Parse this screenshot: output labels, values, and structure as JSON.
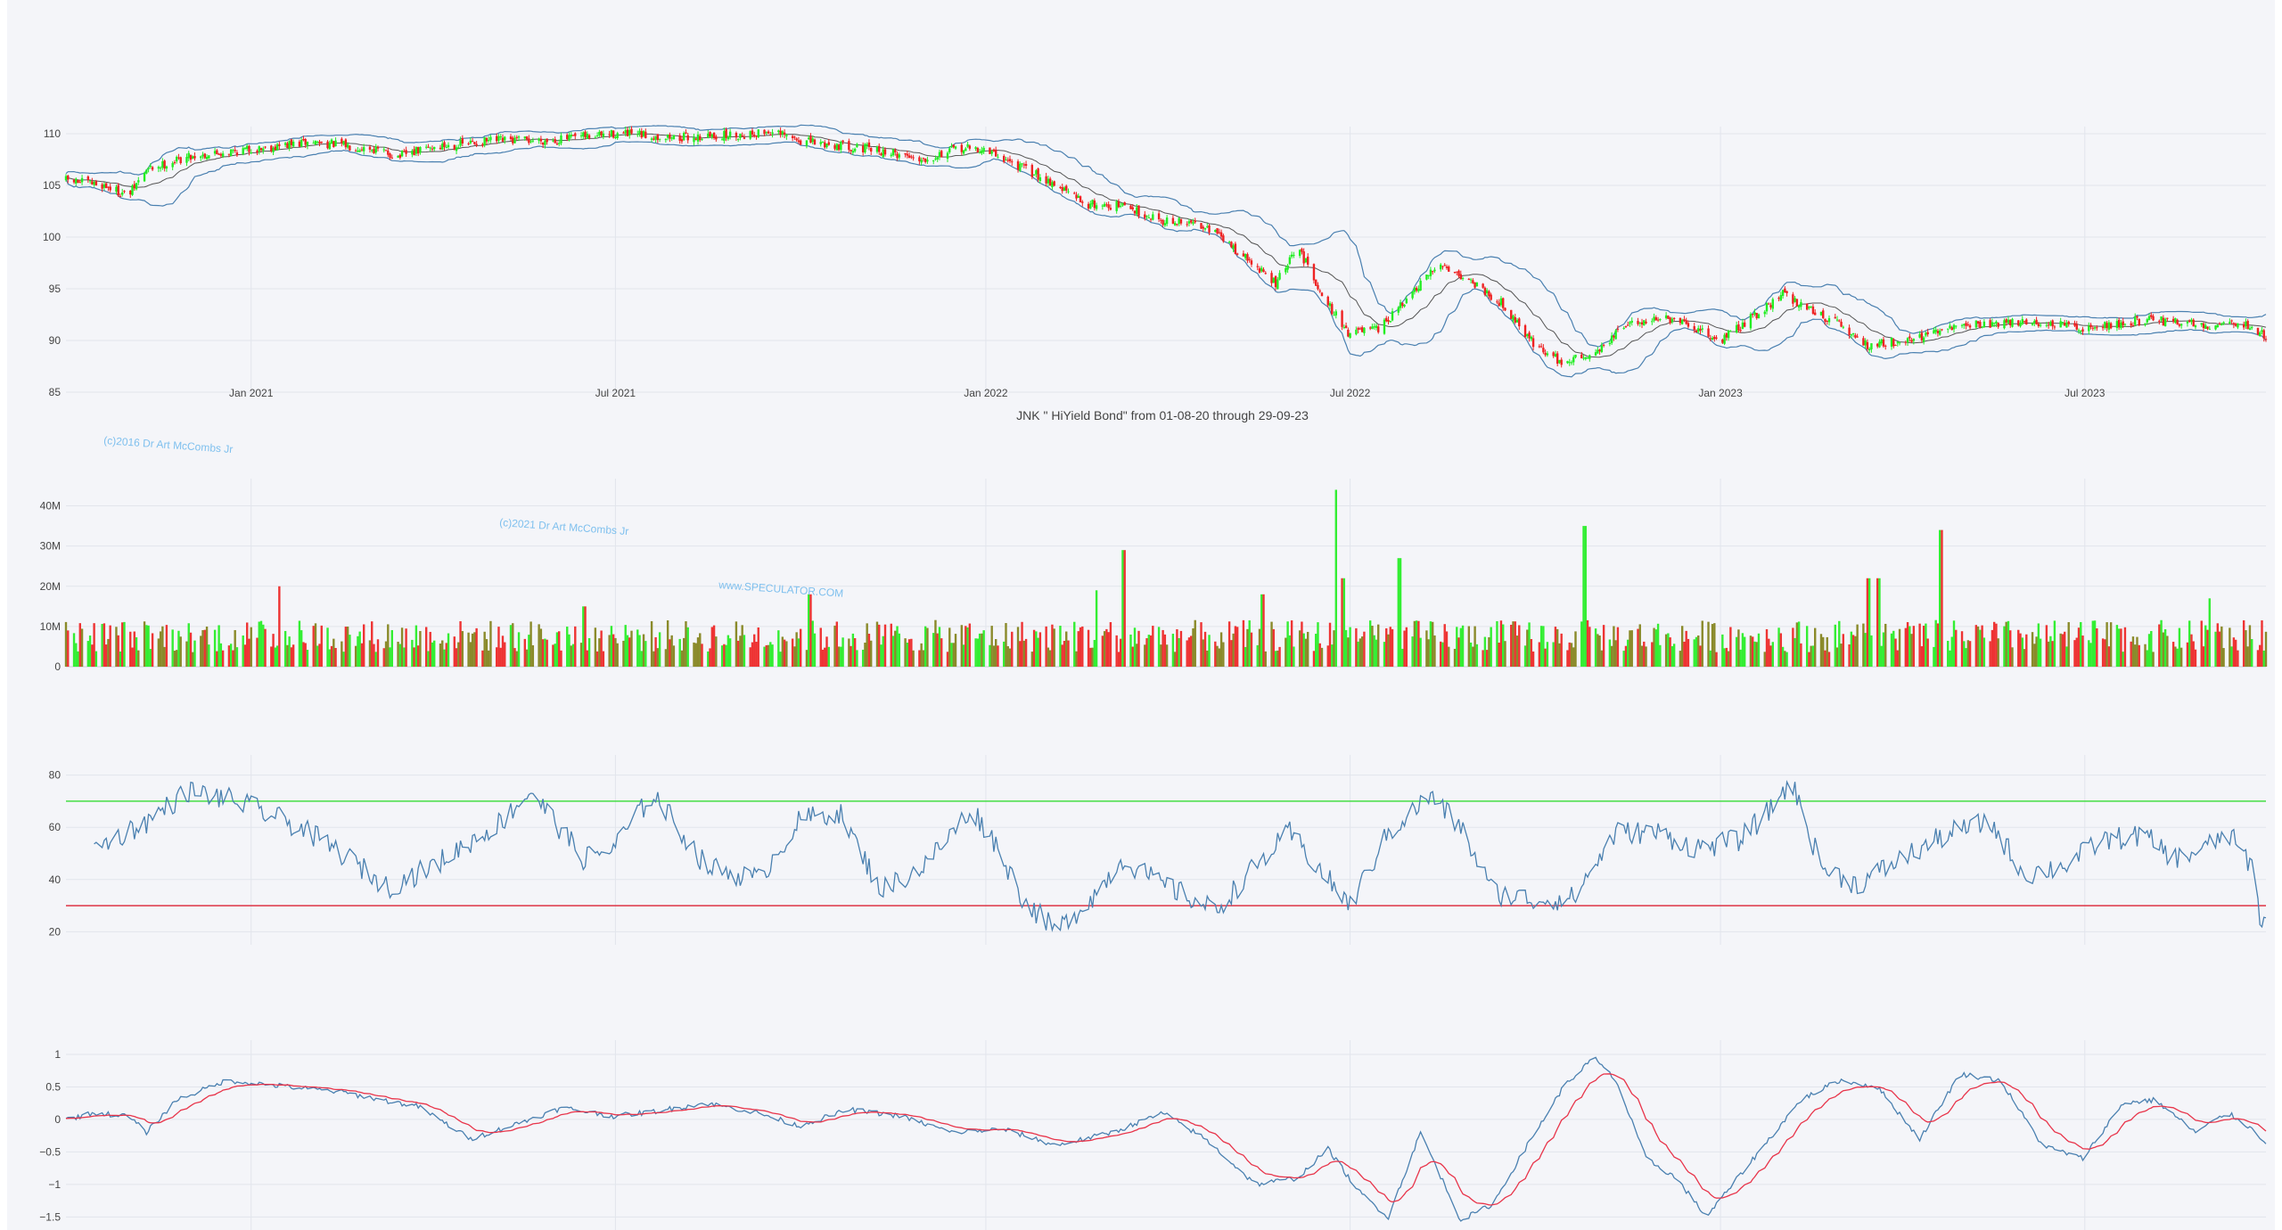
{
  "colors": {
    "background": "#f4f5f9",
    "grid": "#e2e5ec",
    "axis_text": "#444444",
    "up": "#22ee22",
    "down": "#ee2222",
    "band": "#4a80b0",
    "signal": "#e8344a",
    "overbought": "#44dd44",
    "oversold": "#dd3344",
    "watermark": "#7fc0ee"
  },
  "chart_data": [
    {
      "type": "candlestick",
      "title": "JNK \" HiYield Bond\" from 01-08-20 through 29-09-23",
      "x_ticks": [
        "Jan 2021",
        "Jul 2021",
        "Jan 2022",
        "Jul 2022",
        "Jan 2023",
        "Jul 2023"
      ],
      "x_range": [
        "2020-10-01",
        "2023-09-29"
      ],
      "y_ticks": [
        "85",
        "90",
        "95",
        "100",
        "105",
        "110"
      ],
      "ylim": [
        85,
        110
      ],
      "close_keypoints": [
        [
          "2020-10-01",
          105.5
        ],
        [
          "2020-10-20",
          105.0
        ],
        [
          "2020-11-01",
          104.0
        ],
        [
          "2020-11-10",
          106.5
        ],
        [
          "2020-12-01",
          107.8
        ],
        [
          "2021-01-01",
          108.5
        ],
        [
          "2021-02-01",
          109.2
        ],
        [
          "2021-03-01",
          108.6
        ],
        [
          "2021-03-15",
          107.8
        ],
        [
          "2021-04-01",
          108.7
        ],
        [
          "2021-05-01",
          109.3
        ],
        [
          "2021-06-01",
          109.4
        ],
        [
          "2021-07-01",
          110.0
        ],
        [
          "2021-08-01",
          109.6
        ],
        [
          "2021-09-01",
          109.9
        ],
        [
          "2021-09-15",
          110.2
        ],
        [
          "2021-10-01",
          109.3
        ],
        [
          "2021-11-01",
          108.6
        ],
        [
          "2021-12-01",
          107.6
        ],
        [
          "2021-12-20",
          108.6
        ],
        [
          "2022-01-01",
          108.4
        ],
        [
          "2022-02-01",
          105.5
        ],
        [
          "2022-02-20",
          103.2
        ],
        [
          "2022-03-10",
          103.0
        ],
        [
          "2022-04-01",
          101.5
        ],
        [
          "2022-04-20",
          101.2
        ],
        [
          "2022-05-10",
          98.0
        ],
        [
          "2022-05-25",
          95.5
        ],
        [
          "2022-06-05",
          99.0
        ],
        [
          "2022-06-20",
          93.5
        ],
        [
          "2022-06-30",
          90.8
        ],
        [
          "2022-07-15",
          91.0
        ],
        [
          "2022-08-01",
          94.5
        ],
        [
          "2022-08-15",
          97.5
        ],
        [
          "2022-09-01",
          95.5
        ],
        [
          "2022-09-15",
          93.5
        ],
        [
          "2022-10-01",
          89.5
        ],
        [
          "2022-10-15",
          87.8
        ],
        [
          "2022-11-01",
          89.0
        ],
        [
          "2022-11-15",
          91.5
        ],
        [
          "2022-12-01",
          92.2
        ],
        [
          "2022-12-15",
          91.5
        ],
        [
          "2023-01-01",
          90.0
        ],
        [
          "2023-01-15",
          92.0
        ],
        [
          "2023-02-01",
          94.5
        ],
        [
          "2023-02-15",
          93.0
        ],
        [
          "2023-03-01",
          91.5
        ],
        [
          "2023-03-15",
          89.5
        ],
        [
          "2023-04-01",
          90.0
        ],
        [
          "2023-04-15",
          90.5
        ],
        [
          "2023-05-01",
          91.5
        ],
        [
          "2023-06-01",
          91.8
        ],
        [
          "2023-07-01",
          91.2
        ],
        [
          "2023-08-01",
          92.0
        ],
        [
          "2023-09-01",
          91.5
        ],
        [
          "2023-09-15",
          91.8
        ],
        [
          "2023-09-29",
          90.5
        ]
      ],
      "bollinger": true
    },
    {
      "type": "bar",
      "name": "volume",
      "x_range": [
        "2020-10-01",
        "2023-09-29"
      ],
      "y_ticks": [
        "0",
        "10M",
        "20M",
        "30M",
        "40M"
      ],
      "ylim": [
        0,
        45000000
      ],
      "typical_volume": 8000000,
      "spikes": [
        [
          "2021-01-15",
          20000000
        ],
        [
          "2021-06-15",
          15000000
        ],
        [
          "2021-10-05",
          18000000
        ],
        [
          "2022-02-25",
          19000000
        ],
        [
          "2022-03-10",
          29000000
        ],
        [
          "2022-05-18",
          18000000
        ],
        [
          "2022-06-24",
          44000000
        ],
        [
          "2022-06-27",
          22000000
        ],
        [
          "2022-07-25",
          27000000
        ],
        [
          "2022-10-25",
          35000000
        ],
        [
          "2023-03-15",
          22000000
        ],
        [
          "2023-03-20",
          22000000
        ],
        [
          "2023-04-20",
          34000000
        ],
        [
          "2023-09-01",
          17000000
        ]
      ]
    },
    {
      "type": "line",
      "name": "oscillator",
      "x_range": [
        "2020-10-01",
        "2023-09-29"
      ],
      "y_ticks": [
        "20",
        "40",
        "60",
        "80"
      ],
      "ylim": [
        15,
        85
      ],
      "overbought": 70,
      "oversold": 30,
      "keypoints": [
        [
          "2020-10-15",
          52
        ],
        [
          "2020-11-10",
          62
        ],
        [
          "2020-12-01",
          74
        ],
        [
          "2020-12-25",
          70
        ],
        [
          "2021-01-25",
          60
        ],
        [
          "2021-02-15",
          50
        ],
        [
          "2021-03-10",
          37
        ],
        [
          "2021-04-01",
          45
        ],
        [
          "2021-05-05",
          62
        ],
        [
          "2021-05-20",
          74
        ],
        [
          "2021-06-15",
          48
        ],
        [
          "2021-06-30",
          52
        ],
        [
          "2021-07-20",
          73
        ],
        [
          "2021-08-15",
          45
        ],
        [
          "2021-09-10",
          40
        ],
        [
          "2021-10-01",
          63
        ],
        [
          "2021-10-20",
          66
        ],
        [
          "2021-11-10",
          36
        ],
        [
          "2021-12-01",
          45
        ],
        [
          "2021-12-25",
          67
        ],
        [
          "2022-01-05",
          55
        ],
        [
          "2022-01-20",
          32
        ],
        [
          "2022-02-05",
          20
        ],
        [
          "2022-02-25",
          35
        ],
        [
          "2022-03-10",
          48
        ],
        [
          "2022-03-25",
          40
        ],
        [
          "2022-04-10",
          34
        ],
        [
          "2022-04-25",
          28
        ],
        [
          "2022-05-15",
          45
        ],
        [
          "2022-06-01",
          58
        ],
        [
          "2022-06-20",
          40
        ],
        [
          "2022-07-01",
          30
        ],
        [
          "2022-07-20",
          58
        ],
        [
          "2022-08-10",
          72
        ],
        [
          "2022-08-25",
          60
        ],
        [
          "2022-09-10",
          35
        ],
        [
          "2022-10-01",
          32
        ],
        [
          "2022-10-20",
          33
        ],
        [
          "2022-11-10",
          58
        ],
        [
          "2022-12-01",
          58
        ],
        [
          "2022-12-20",
          52
        ],
        [
          "2023-01-10",
          55
        ],
        [
          "2023-01-25",
          66
        ],
        [
          "2023-02-05",
          78
        ],
        [
          "2023-02-20",
          45
        ],
        [
          "2023-03-10",
          38
        ],
        [
          "2023-04-01",
          48
        ],
        [
          "2023-04-25",
          58
        ],
        [
          "2023-05-15",
          62
        ],
        [
          "2023-06-01",
          42
        ],
        [
          "2023-06-20",
          45
        ],
        [
          "2023-07-10",
          55
        ],
        [
          "2023-07-30",
          57
        ],
        [
          "2023-08-15",
          48
        ],
        [
          "2023-08-30",
          52
        ],
        [
          "2023-09-10",
          58
        ],
        [
          "2023-09-22",
          45
        ],
        [
          "2023-09-27",
          22
        ],
        [
          "2023-09-29",
          28
        ]
      ]
    },
    {
      "type": "line",
      "name": "momentum",
      "x_range": [
        "2020-10-01",
        "2023-09-29"
      ],
      "y_ticks": [
        "−1.5",
        "−1",
        "−0.5",
        "0",
        "0.5",
        "1"
      ],
      "ylim": [
        -1.7,
        1.15
      ],
      "keypoints": [
        [
          "2020-10-01",
          0.0
        ],
        [
          "2020-10-15",
          0.1
        ],
        [
          "2020-11-01",
          0.05
        ],
        [
          "2020-11-10",
          -0.2
        ],
        [
          "2020-11-25",
          0.3
        ],
        [
          "2020-12-20",
          0.6
        ],
        [
          "2021-01-20",
          0.5
        ],
        [
          "2021-02-15",
          0.42
        ],
        [
          "2021-03-10",
          0.28
        ],
        [
          "2021-03-25",
          0.2
        ],
        [
          "2021-04-20",
          -0.3
        ],
        [
          "2021-05-10",
          -0.1
        ],
        [
          "2021-06-05",
          0.18
        ],
        [
          "2021-06-30",
          0.05
        ],
        [
          "2021-07-20",
          0.12
        ],
        [
          "2021-08-15",
          0.25
        ],
        [
          "2021-09-10",
          0.1
        ],
        [
          "2021-09-30",
          -0.1
        ],
        [
          "2021-10-25",
          0.15
        ],
        [
          "2021-11-20",
          0.05
        ],
        [
          "2021-12-15",
          -0.2
        ],
        [
          "2022-01-10",
          -0.15
        ],
        [
          "2022-02-05",
          -0.4
        ],
        [
          "2022-03-05",
          -0.2
        ],
        [
          "2022-03-30",
          0.1
        ],
        [
          "2022-04-20",
          -0.3
        ],
        [
          "2022-05-15",
          -1.0
        ],
        [
          "2022-06-05",
          -0.9
        ],
        [
          "2022-06-20",
          -0.45
        ],
        [
          "2022-07-05",
          -1.1
        ],
        [
          "2022-07-20",
          -1.5
        ],
        [
          "2022-08-05",
          -0.2
        ],
        [
          "2022-08-25",
          -1.55
        ],
        [
          "2022-09-10",
          -1.3
        ],
        [
          "2022-09-25",
          -0.5
        ],
        [
          "2022-10-15",
          0.5
        ],
        [
          "2022-10-30",
          0.95
        ],
        [
          "2022-11-10",
          0.6
        ],
        [
          "2022-11-25",
          -0.6
        ],
        [
          "2022-12-10",
          -0.9
        ],
        [
          "2022-12-25",
          -1.5
        ],
        [
          "2023-01-20",
          -0.5
        ],
        [
          "2023-02-10",
          0.3
        ],
        [
          "2023-03-01",
          0.6
        ],
        [
          "2023-03-20",
          0.5
        ],
        [
          "2023-04-10",
          -0.3
        ],
        [
          "2023-04-30",
          0.7
        ],
        [
          "2023-05-20",
          0.6
        ],
        [
          "2023-06-10",
          -0.4
        ],
        [
          "2023-06-30",
          -0.6
        ],
        [
          "2023-07-20",
          0.25
        ],
        [
          "2023-08-05",
          0.3
        ],
        [
          "2023-08-25",
          -0.2
        ],
        [
          "2023-09-10",
          0.1
        ],
        [
          "2023-09-20",
          -0.1
        ],
        [
          "2023-09-29",
          -0.35
        ]
      ]
    }
  ],
  "watermarks": [
    "(c)2016 Dr Art McCombs Jr",
    "(c)2021 Dr Art McCombs Jr",
    "www.SPECULATOR.COM"
  ]
}
